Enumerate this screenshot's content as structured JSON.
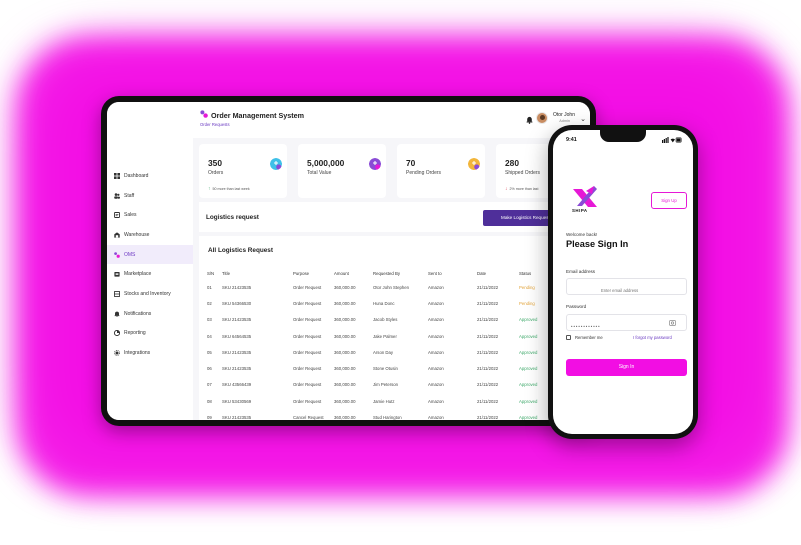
{
  "tablet": {
    "app_title": "Order Management System",
    "breadcrumb": "Order Requests",
    "user": {
      "name": "Otor John",
      "role": "Admin"
    },
    "sidebar": [
      {
        "label": "Dashboard",
        "icon": "dashboard-icon"
      },
      {
        "label": "Staff",
        "icon": "staff-icon"
      },
      {
        "label": "Sales",
        "icon": "sales-icon"
      },
      {
        "label": "Warehouse",
        "icon": "warehouse-icon"
      },
      {
        "label": "OMS",
        "icon": "oms-icon",
        "active": true
      },
      {
        "label": "Marketplace",
        "icon": "marketplace-icon"
      },
      {
        "label": "Stocks and Inventory",
        "icon": "inventory-icon"
      },
      {
        "label": "Notifications",
        "icon": "bell-icon"
      },
      {
        "label": "Reporting",
        "icon": "reporting-icon"
      },
      {
        "label": "Integrations",
        "icon": "integrations-icon"
      }
    ],
    "stats": [
      {
        "value": "350",
        "label": "Orders",
        "note": "50 more than last week",
        "trend": "up",
        "badge_color": "#3ec0e8"
      },
      {
        "value": "5,000,000",
        "label": "Total Value",
        "note": "",
        "badge_color": "#8a4bd6"
      },
      {
        "value": "70",
        "label": "Pending Orders",
        "note": "",
        "badge_color": "#f2b53a"
      },
      {
        "value": "280",
        "label": "Shipped Orders",
        "note": "2% more than last",
        "trend": "down",
        "badge_color": "#8a4bd6"
      }
    ],
    "logistics": {
      "title": "Logistics request",
      "button": "Make Logistics Request"
    },
    "table": {
      "title": "All Logistics Request",
      "columns": [
        "S/N",
        "Title",
        "Purpose",
        "Amount",
        "Requested By",
        "Sent to",
        "Date",
        "Status"
      ],
      "rows": [
        [
          "01",
          "SKU 21423535",
          "Order Request",
          "360,000.00",
          "Otor John Stephen",
          "Amazon",
          "21/11/2022",
          "Pending"
        ],
        [
          "02",
          "SKU 54366530",
          "Order Request",
          "360,000.00",
          "Huna Donc",
          "Amazon",
          "21/11/2022",
          "Pending"
        ],
        [
          "03",
          "SKU 21423535",
          "Order Request",
          "360,000.00",
          "Jacob Styles",
          "Amazon",
          "21/11/2022",
          "Approved"
        ],
        [
          "04",
          "SKU 64564535",
          "Order Request",
          "360,000.00",
          "Jake Palmer",
          "Amazon",
          "21/11/2022",
          "Approved"
        ],
        [
          "05",
          "SKU 21423535",
          "Order Request",
          "360,000.00",
          "Arson Day",
          "Amazon",
          "21/11/2022",
          "Approved"
        ],
        [
          "06",
          "SKU 21423535",
          "Order Request",
          "360,000.00",
          "Stone Otusin",
          "Amazon",
          "21/11/2022",
          "Approved"
        ],
        [
          "07",
          "SKU 43566439",
          "Order Request",
          "360,000.00",
          "Jim Peterson",
          "Amazon",
          "21/11/2022",
          "Approved"
        ],
        [
          "08",
          "SKU 53430569",
          "Order Request",
          "360,000.00",
          "Jamie Hutz",
          "Amazon",
          "21/11/2022",
          "Approved"
        ],
        [
          "09",
          "SKU 21423535",
          "Cancel Request",
          "360,000.00",
          "Stud Harington",
          "Amazon",
          "21/11/2022",
          "Approved"
        ]
      ]
    }
  },
  "phone": {
    "time": "9:41",
    "brand": "SHIPA",
    "signup": "Sign Up",
    "welcome": "Welcome back!",
    "title": "Please Sign In",
    "email_label": "Email address",
    "email_placeholder": "Enter email address",
    "password_label": "Password",
    "password_value": "••••••••••••",
    "remember": "Remember me",
    "forgot": "I forgot my password",
    "signin_button": "Sign In"
  },
  "colors": {
    "glow": "#f40fe6",
    "accent": "#f20ee3",
    "purple": "#4f2f9a",
    "pending": "#e2a43b",
    "approved": "#3ea96a"
  }
}
